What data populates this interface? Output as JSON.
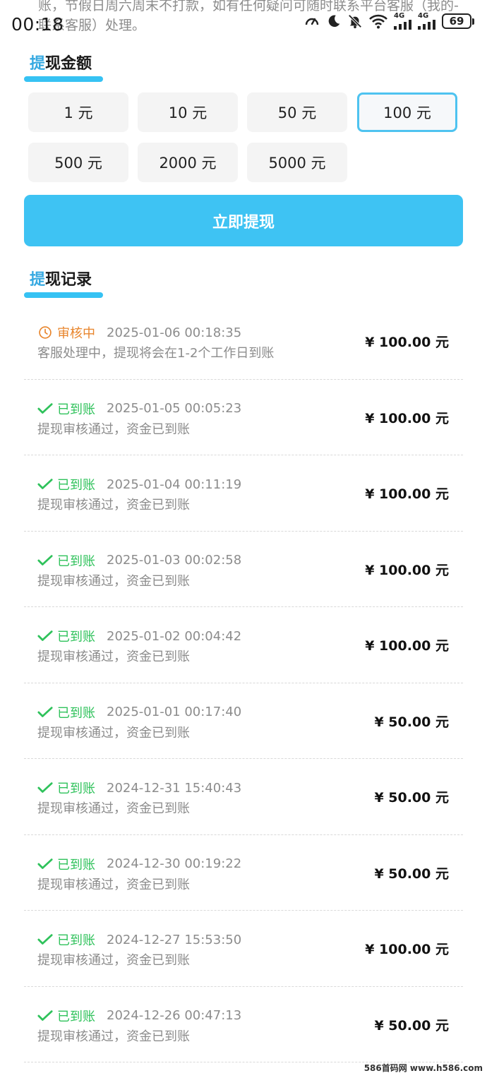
{
  "status_bar": {
    "notice": "账，节假日周六周末不打款，如有任何疑问可随时联系平台客服（我的-联系客服）处理。",
    "time": "00:18",
    "network_1": "4G",
    "network_2": "4G",
    "battery": "69",
    "icons": [
      "speed-icon",
      "moon-icon",
      "mute-bell-icon",
      "wifi-icon",
      "signal-icon",
      "signal-icon",
      "battery-icon"
    ]
  },
  "amount_section": {
    "title_accent": "提",
    "title_rest": "现金额",
    "options": [
      "1 元",
      "10 元",
      "50 元",
      "100 元",
      "500 元",
      "2000 元",
      "5000 元"
    ],
    "selected": "100 元"
  },
  "withdraw_button": {
    "label": "立即提现"
  },
  "records_section": {
    "title_accent": "提",
    "title_rest": "现记录",
    "items": [
      {
        "status": "审核中",
        "status_type": "pending",
        "time": "2025-01-06 00:18:35",
        "desc": "客服处理中，提现将会在1-2个工作日到账",
        "amount": "¥ 100.00 元"
      },
      {
        "status": "已到账",
        "status_type": "done",
        "time": "2025-01-05 00:05:23",
        "desc": "提现审核通过，资金已到账",
        "amount": "¥ 100.00 元"
      },
      {
        "status": "已到账",
        "status_type": "done",
        "time": "2025-01-04 00:11:19",
        "desc": "提现审核通过，资金已到账",
        "amount": "¥ 100.00 元"
      },
      {
        "status": "已到账",
        "status_type": "done",
        "time": "2025-01-03 00:02:58",
        "desc": "提现审核通过，资金已到账",
        "amount": "¥ 100.00 元"
      },
      {
        "status": "已到账",
        "status_type": "done",
        "time": "2025-01-02 00:04:42",
        "desc": "提现审核通过，资金已到账",
        "amount": "¥ 100.00 元"
      },
      {
        "status": "已到账",
        "status_type": "done",
        "time": "2025-01-01 00:17:40",
        "desc": "提现审核通过，资金已到账",
        "amount": "¥ 50.00 元"
      },
      {
        "status": "已到账",
        "status_type": "done",
        "time": "2024-12-31 15:40:43",
        "desc": "提现审核通过，资金已到账",
        "amount": "¥ 50.00 元"
      },
      {
        "status": "已到账",
        "status_type": "done",
        "time": "2024-12-30 00:19:22",
        "desc": "提现审核通过，资金已到账",
        "amount": "¥ 50.00 元"
      },
      {
        "status": "已到账",
        "status_type": "done",
        "time": "2024-12-27 15:53:50",
        "desc": "提现审核通过，资金已到账",
        "amount": "¥ 100.00 元"
      },
      {
        "status": "已到账",
        "status_type": "done",
        "time": "2024-12-26 00:47:13",
        "desc": "提现审核通过，资金已到账",
        "amount": "¥ 50.00 元"
      }
    ]
  },
  "watermark": "586首码网 www.h586.com",
  "colors": {
    "accent": "#36a9e1",
    "button": "#3ec3f3",
    "pending": "#e8852c",
    "done": "#2fc25b",
    "muted": "#8c8c8c"
  }
}
